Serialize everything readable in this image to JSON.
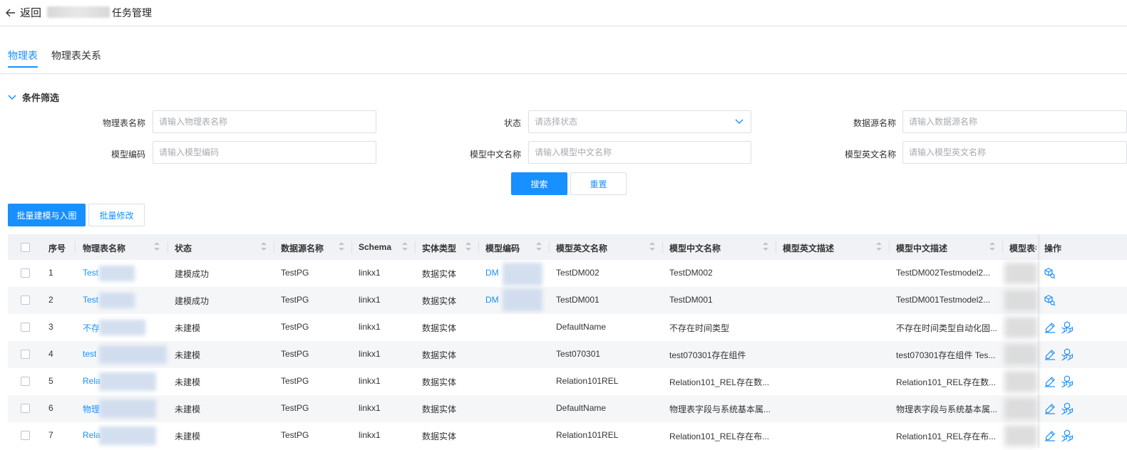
{
  "header": {
    "back_label": "返回",
    "title": "任务管理"
  },
  "tabs": [
    {
      "label": "物理表",
      "active": true
    },
    {
      "label": "物理表关系",
      "active": false
    }
  ],
  "filter": {
    "title": "条件筛选",
    "fields": {
      "table_name": {
        "label": "物理表名称",
        "placeholder": "请输入物理表名称"
      },
      "status": {
        "label": "状态",
        "placeholder": "请选择状态"
      },
      "datasource": {
        "label": "数据源名称",
        "placeholder": "请输入数据源名称"
      },
      "model_code": {
        "label": "模型编码",
        "placeholder": "请输入模型编码"
      },
      "model_cn": {
        "label": "模型中文名称",
        "placeholder": "请输入模型中文名称"
      },
      "model_en": {
        "label": "模型英文名称",
        "placeholder": "请输入模型英文名称"
      }
    },
    "search_label": "搜索",
    "reset_label": "重置"
  },
  "actions": {
    "batch_model_label": "批量建模与入图",
    "batch_edit_label": "批量修改"
  },
  "table": {
    "columns": {
      "index": "序号",
      "name": "物理表名称",
      "status": "状态",
      "datasource": "数据源名称",
      "schema": "Schema",
      "entity_type": "实体类型",
      "model_code": "模型编码",
      "model_en": "模型英文名称",
      "model_cn": "模型中文名称",
      "model_en_desc": "模型英文描述",
      "model_cn_desc": "模型中文描述",
      "model_table": "模型表名",
      "ops": "操作"
    },
    "rows": [
      {
        "index": "1",
        "name": "Test",
        "status": "建模成功",
        "datasource": "TestPG",
        "schema": "linkx1",
        "entity_type": "数据实体",
        "model_code": "DM",
        "model_en": "TestDM002",
        "model_cn": "TestDM002",
        "model_en_desc": "",
        "model_cn_desc": "TestDM002Testmodel2...",
        "ops": "view"
      },
      {
        "index": "2",
        "name": "Test",
        "status": "建模成功",
        "datasource": "TestPG",
        "schema": "linkx1",
        "entity_type": "数据实体",
        "model_code": "DM",
        "model_en": "TestDM001",
        "model_cn": "TestDM001",
        "model_en_desc": "",
        "model_cn_desc": "TestDM001Testmodel2...",
        "ops": "view"
      },
      {
        "index": "3",
        "name": "不存",
        "status": "未建模",
        "datasource": "TestPG",
        "schema": "linkx1",
        "entity_type": "数据实体",
        "model_code": "",
        "model_en": "DefaultName",
        "model_cn": "不存在时间类型",
        "model_en_desc": "",
        "model_cn_desc": "不存在时间类型自动化固...",
        "ops": "edit"
      },
      {
        "index": "4",
        "name": "test",
        "status": "未建模",
        "datasource": "TestPG",
        "schema": "linkx1",
        "entity_type": "数据实体",
        "model_code": "",
        "model_en": "Test070301",
        "model_cn": "test070301存在组件",
        "model_en_desc": "",
        "model_cn_desc": "test070301存在组件 Tes...",
        "ops": "edit"
      },
      {
        "index": "5",
        "name": "Rela",
        "status": "未建模",
        "datasource": "TestPG",
        "schema": "linkx1",
        "entity_type": "数据实体",
        "model_code": "",
        "model_en": "Relation101REL",
        "model_cn": "Relation101_REL存在数...",
        "model_en_desc": "",
        "model_cn_desc": "Relation101_REL存在数...",
        "ops": "edit"
      },
      {
        "index": "6",
        "name": "物理",
        "status": "未建模",
        "datasource": "TestPG",
        "schema": "linkx1",
        "entity_type": "数据实体",
        "model_code": "",
        "model_en": "DefaultName",
        "model_cn": "物理表字段与系统基本属...",
        "model_en_desc": "",
        "model_cn_desc": "物理表字段与系统基本属...",
        "ops": "edit"
      },
      {
        "index": "7",
        "name": "Rela",
        "status": "未建模",
        "datasource": "TestPG",
        "schema": "linkx1",
        "entity_type": "数据实体",
        "model_code": "",
        "model_en": "Relation101REL",
        "model_cn": "Relation101_REL存在布...",
        "model_en_desc": "",
        "model_cn_desc": "Relation101_REL存在布...",
        "ops": "edit"
      }
    ]
  },
  "colors": {
    "primary": "#1890ff",
    "header_bg": "#f0f2f5",
    "alt_row_bg": "#f5f6f8"
  }
}
